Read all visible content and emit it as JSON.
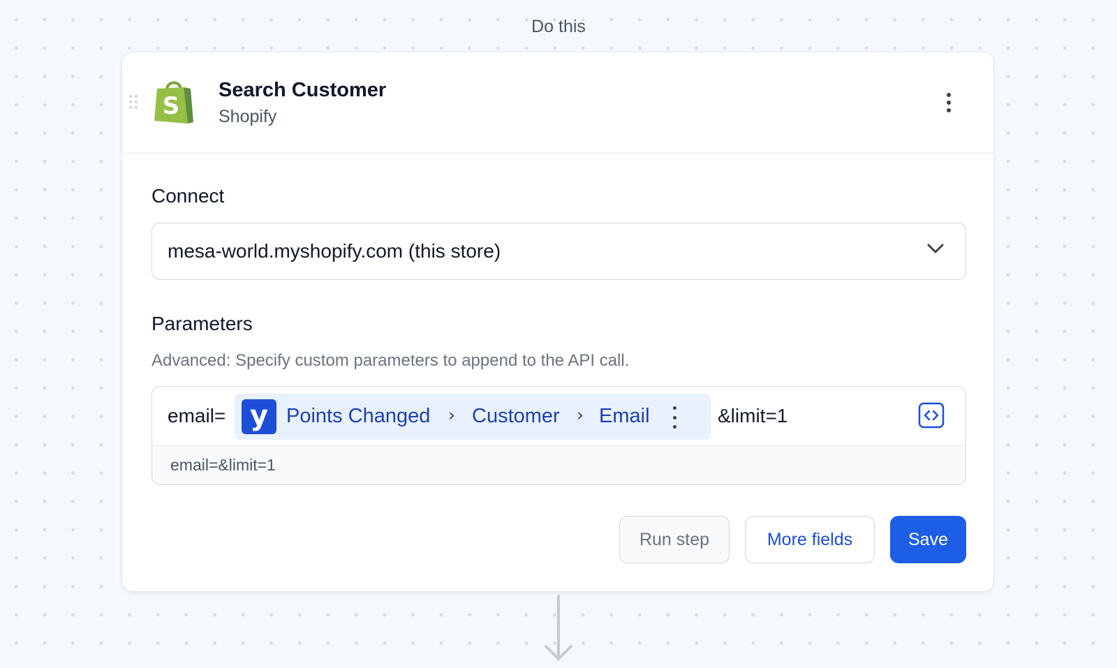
{
  "section_label": "Do this",
  "step": {
    "title": "Search Customer",
    "app_name": "Shopify",
    "icons": {
      "drag": "drag-handle-icon",
      "logo": "shopify-bag-icon",
      "menu": "more-vertical-icon"
    }
  },
  "connect": {
    "label": "Connect",
    "selected": "mesa-world.myshopify.com (this store)",
    "chevron_icon": "chevron-down-icon"
  },
  "parameters": {
    "label": "Parameters",
    "help": "Advanced: Specify custom parameters to append to the API call.",
    "prefix": "email=",
    "token": {
      "icon_letter": "y",
      "path": [
        "Points Changed",
        "Customer",
        "Email"
      ],
      "separator": "›"
    },
    "suffix": "&limit=1",
    "preview": "email=&limit=1",
    "code_icon": "code-brackets-icon"
  },
  "buttons": {
    "run_step": "Run step",
    "more_fields": "More fields",
    "save": "Save"
  },
  "colors": {
    "accent": "#1d5ee6",
    "token_bg": "#e8f1fc",
    "token_text": "#1e40af",
    "shopify_green": "#95bf47"
  }
}
